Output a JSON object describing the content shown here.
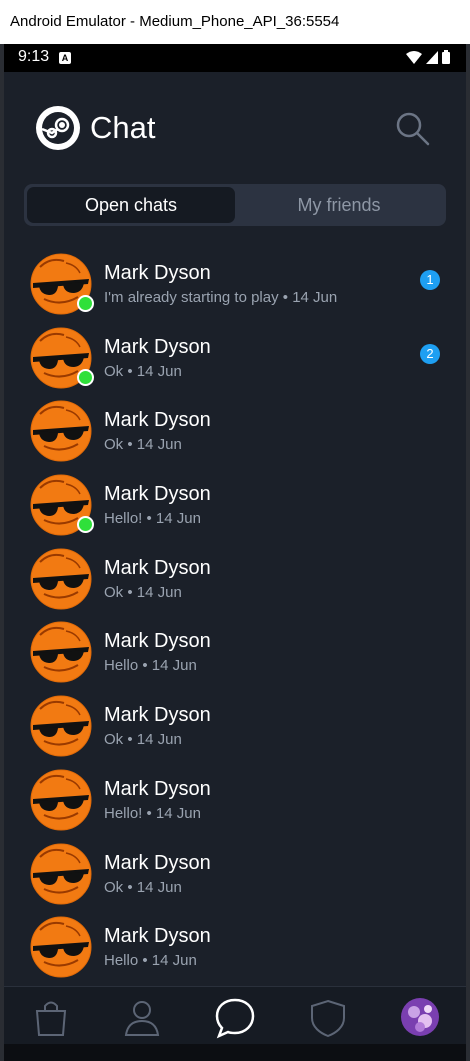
{
  "window": {
    "title": "Android Emulator - Medium_Phone_API_36:5554"
  },
  "statusbar": {
    "time": "9:13",
    "notification_letter": "A"
  },
  "header": {
    "title": "Chat",
    "logo_icon": "steam-icon",
    "search_icon": "search-icon"
  },
  "tabs": [
    {
      "label": "Open chats",
      "active": true
    },
    {
      "label": "My friends",
      "active": false
    }
  ],
  "chats": [
    {
      "name": "Mark Dyson",
      "preview": "I'm already starting to play • 14 Jun",
      "online": true,
      "unread": "1"
    },
    {
      "name": "Mark Dyson",
      "preview": "Ok • 14 Jun",
      "online": true,
      "unread": "2"
    },
    {
      "name": "Mark Dyson",
      "preview": "Ok • 14 Jun",
      "online": false,
      "unread": null
    },
    {
      "name": "Mark Dyson",
      "preview": "Hello! • 14 Jun",
      "online": true,
      "unread": null
    },
    {
      "name": "Mark Dyson",
      "preview": "Ok • 14 Jun",
      "online": false,
      "unread": null
    },
    {
      "name": "Mark Dyson",
      "preview": "Hello • 14 Jun",
      "online": false,
      "unread": null
    },
    {
      "name": "Mark Dyson",
      "preview": "Ok • 14 Jun",
      "online": false,
      "unread": null
    },
    {
      "name": "Mark Dyson",
      "preview": "Hello! • 14 Jun",
      "online": false,
      "unread": null
    },
    {
      "name": "Mark Dyson",
      "preview": "Ok • 14 Jun",
      "online": false,
      "unread": null
    },
    {
      "name": "Mark Dyson",
      "preview": "Hello • 14 Jun",
      "online": false,
      "unread": null
    }
  ],
  "bottom_nav": [
    {
      "name": "store-bag-icon"
    },
    {
      "name": "profile-icon"
    },
    {
      "name": "chat-bubble-icon",
      "active": true
    },
    {
      "name": "shield-icon"
    },
    {
      "name": "user-avatar"
    }
  ],
  "colors": {
    "accent": "#1e9ff2",
    "online": "#2fe03a",
    "background": "#1b2029"
  }
}
